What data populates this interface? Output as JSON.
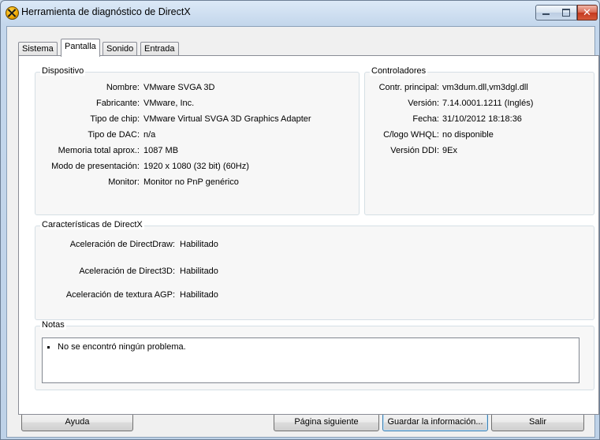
{
  "window": {
    "title": "Herramienta de diagnóstico de DirectX",
    "close_glyph": "✕"
  },
  "tabs": [
    {
      "label": "Sistema"
    },
    {
      "label": "Pantalla"
    },
    {
      "label": "Sonido"
    },
    {
      "label": "Entrada"
    }
  ],
  "active_tab": "Pantalla",
  "device": {
    "title": "Dispositivo",
    "rows": [
      {
        "label": "Nombre:",
        "value": "VMware SVGA 3D"
      },
      {
        "label": "Fabricante:",
        "value": "VMware, Inc."
      },
      {
        "label": "Tipo de chip:",
        "value": "VMware Virtual SVGA 3D Graphics Adapter"
      },
      {
        "label": "Tipo de DAC:",
        "value": "n/a"
      },
      {
        "label": "Memoria total aprox.:",
        "value": "1087 MB"
      },
      {
        "label": "Modo de presentación:",
        "value": "1920 x 1080 (32 bit) (60Hz)"
      },
      {
        "label": "Monitor:",
        "value": "Monitor no PnP genérico"
      }
    ]
  },
  "drivers": {
    "title": "Controladores",
    "rows": [
      {
        "label": "Contr. principal:",
        "value": "vm3dum.dll,vm3dgl.dll"
      },
      {
        "label": "Versión:",
        "value": "7.14.0001.1211 (Inglés)"
      },
      {
        "label": "Fecha:",
        "value": "31/10/2012 18:18:36"
      },
      {
        "label": "C/logo WHQL:",
        "value": "no disponible"
      },
      {
        "label": "Versión DDI:",
        "value": "9Ex"
      }
    ]
  },
  "features": {
    "title": "Características de DirectX",
    "rows": [
      {
        "label": "Aceleración de DirectDraw:",
        "value": "Habilitado"
      },
      {
        "label": "Aceleración de Direct3D:",
        "value": "Habilitado"
      },
      {
        "label": "Aceleración de textura AGP:",
        "value": "Habilitado"
      }
    ]
  },
  "notes": {
    "title": "Notas",
    "items": [
      "No se encontró ningún problema."
    ]
  },
  "buttons": {
    "help": "Ayuda",
    "next_page": "Página siguiente",
    "save_info": "Guardar la información...",
    "exit": "Salir"
  },
  "icons": {
    "app": "directx-icon",
    "minimize": "minimize-icon",
    "maximize": "maximize-icon",
    "close": "close-icon"
  }
}
